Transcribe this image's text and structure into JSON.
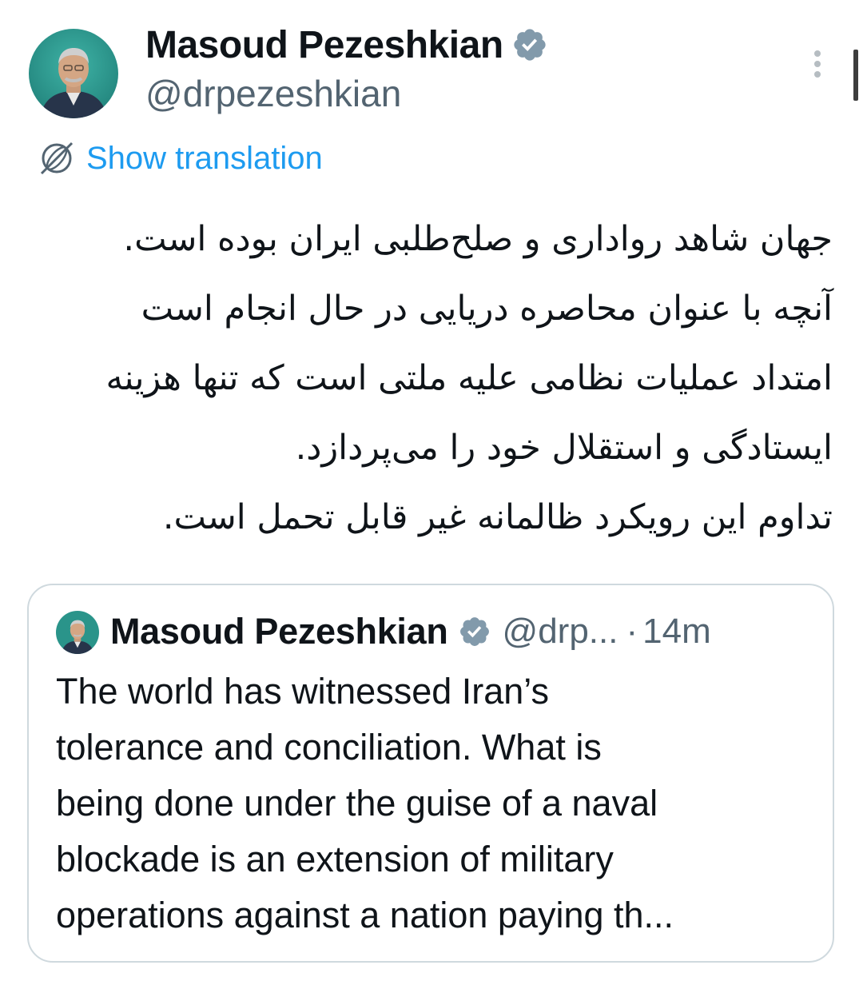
{
  "tweet": {
    "author": {
      "display_name": "Masoud Pezeshkian",
      "handle": "@drpezeshkian",
      "verified": true,
      "avatar_icon": "profile-photo"
    },
    "more_icon": "more-vertical-icon",
    "translate": {
      "icon": "globe-icon",
      "label": "Show translation",
      "color": "#1d9bf0"
    },
    "body_lines": [
      "جهان شاهد رواداری و صلح‌طلبی ایران بوده است.",
      "آنچه با عنوان محاصره دریایی در حال انجام است",
      "امتداد عملیات نظامی علیه ملتی است که تنها هزینه",
      "ایستادگی و استقلال خود را می‌پردازد.",
      "تداوم این رویکرد ظالمانه غیر قابل تحمل است."
    ]
  },
  "quoted_tweet": {
    "author": {
      "display_name": "Masoud Pezeshkian",
      "handle": "@drp...",
      "verified": true
    },
    "separator": "·",
    "timestamp": "14m",
    "text_lines": [
      "The world has witnessed Iran’s",
      "tolerance and conciliation. What is",
      "being done under the guise of a naval",
      "blockade is an extension of military",
      "operations against a nation paying th..."
    ]
  },
  "colors": {
    "text_primary": "#0f1419",
    "text_secondary": "#536471",
    "link": "#1d9bf0",
    "verified_badge": "#829aab",
    "border": "#cfd9de"
  }
}
